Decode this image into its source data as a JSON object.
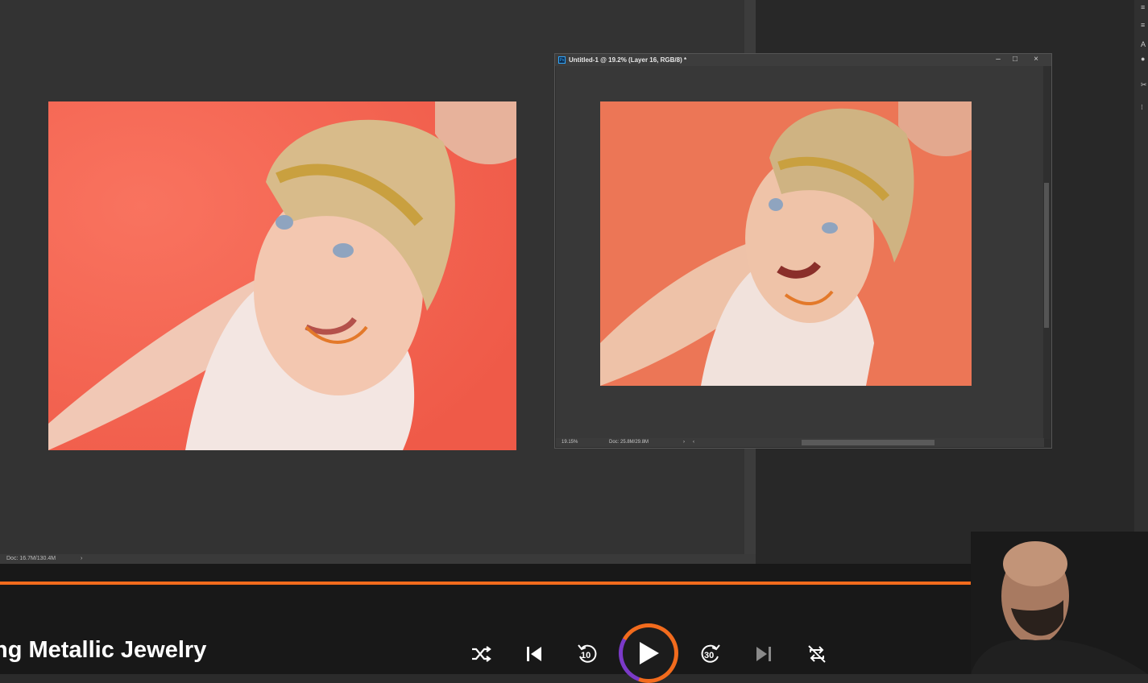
{
  "main_document": {
    "status_doc": "Doc: 16.7M/130.4M",
    "status_arrow": "›"
  },
  "doc_window": {
    "title": "Untitled-1 @ 19.2% (Layer 16, RGB/8) *",
    "app_icon_label": "Ps",
    "minimize": "–",
    "maximize": "□",
    "close": "×",
    "zoom": "19.15%",
    "doc_size": "Doc: 25.8M/29.8M",
    "status_arrow": "›",
    "status_arrow_left": "‹"
  },
  "player": {
    "title": "ng Metallic Jewelry",
    "progress": 1.0,
    "skip_back_label": "10",
    "skip_forward_label": "30",
    "accent_color": "#f26b1d",
    "controls": [
      "shuffle-icon",
      "previous-icon",
      "rewind-10-icon",
      "play-icon",
      "forward-30-icon",
      "next-icon",
      "repeat-off-icon"
    ]
  }
}
